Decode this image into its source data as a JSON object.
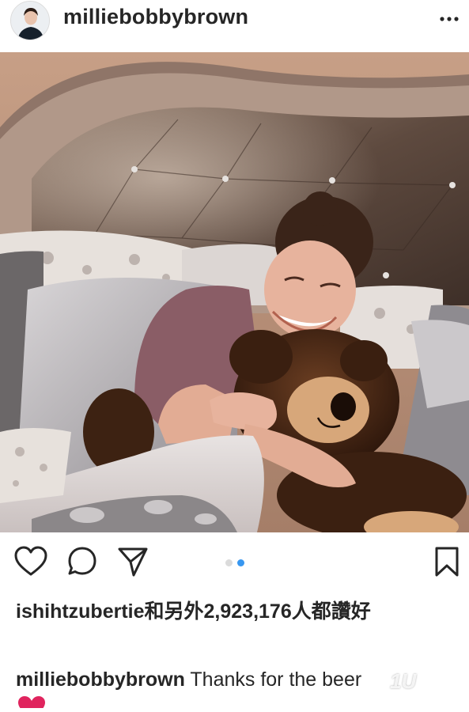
{
  "post": {
    "username": "milliebobbybrown",
    "photo": {
      "description_icon": "photo"
    },
    "carousel": {
      "total": 2,
      "active_index": 1,
      "active_color": "#3897f0",
      "inactive_color": "#dbdbdb"
    },
    "likes_text": "ishihtzubertie和另外2,923,176人都讚好",
    "caption": {
      "username": "milliebobbybrown",
      "text": "Thanks for the beer"
    },
    "watermark": "1U"
  },
  "icons": {
    "more": "more-dots-icon",
    "like": "heart-outline-icon",
    "comment": "comment-bubble-icon",
    "share": "send-paper-plane-icon",
    "save": "bookmark-icon",
    "emoji": "red-heart-emoji"
  }
}
